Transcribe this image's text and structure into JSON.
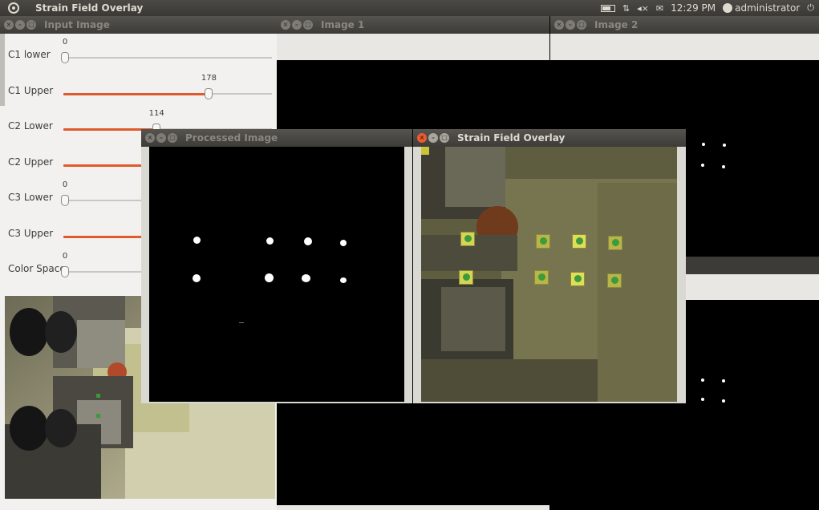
{
  "topbar": {
    "title": "Strain Field Overlay",
    "clock": "12:29 PM",
    "user": "administrator",
    "icons": [
      "ubuntu-logo-icon",
      "battery-icon",
      "network-icon",
      "volume-muted-icon",
      "mail-icon",
      "user-icon",
      "power-icon"
    ]
  },
  "windows": {
    "input_image": {
      "title": "Input Image"
    },
    "image1": {
      "title": "Image 1"
    },
    "image2": {
      "title": "Image 2"
    },
    "processed": {
      "title": "Processed Image"
    },
    "overlay": {
      "title": "Strain Field Overlay"
    }
  },
  "sliders": [
    {
      "label": "C1 lower",
      "value": "0",
      "level": 0,
      "filled": false
    },
    {
      "label": "C1 Upper",
      "value": "178",
      "level": 0.698,
      "filled": true
    },
    {
      "label": "C2 Lower",
      "value": "114",
      "level": 0.447,
      "filled": true
    },
    {
      "label": "C2 Upper",
      "value": "",
      "level": 0.9,
      "filled": true
    },
    {
      "label": "C3 Lower",
      "value": "0",
      "level": 0,
      "filled": false
    },
    {
      "label": "C3 Upper",
      "value": "",
      "level": 0.9,
      "filled": true
    },
    {
      "label": "Color Space",
      "value": "0",
      "level": 0,
      "filled": false
    }
  ],
  "colors": {
    "accent": "#e05a2e",
    "titlebar": "#3c3b37",
    "panel": "#f2f1f0",
    "marker": "#e0e060"
  }
}
